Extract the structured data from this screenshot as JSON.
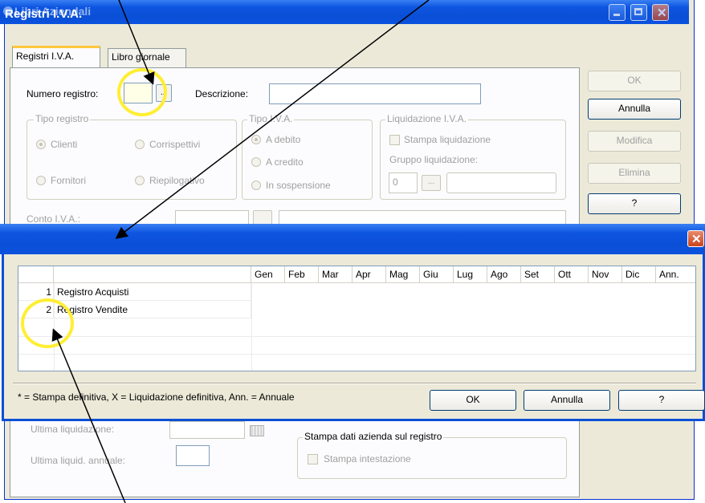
{
  "back_window": {
    "title": "Libri Aziendali",
    "tabs": [
      {
        "label": "Registri I.V.A."
      },
      {
        "label": "Libro giornale"
      }
    ],
    "numero_registro_label": "Numero registro:",
    "numero_registro_value": "",
    "lookup_button": "...",
    "descrizione_label": "Descrizione:",
    "descrizione_value": "",
    "tipo_registro": {
      "title": "Tipo registro",
      "options": [
        "Clienti",
        "Corrispettivi",
        "Fornitori",
        "Riepilogativo"
      ],
      "selected": "Clienti"
    },
    "tipo_iva": {
      "title": "Tipo I.V.A.",
      "options": [
        "A debito",
        "A credito",
        "In sospensione"
      ],
      "selected": "A debito"
    },
    "liquidazione_iva": {
      "title": "Liquidazione I.V.A.",
      "stampa_label": "Stampa liquidazione",
      "gruppo_label": "Gruppo liquidazione:",
      "gruppo_value": "0",
      "lookup_button": "..."
    },
    "conto_iva_label": "Conto I.V.A.:",
    "ultima_liquidazione_label": "Ultima liquidazione:",
    "ultima_liquid_annuale_label": "Ultima liquid. annuale:",
    "stampa_dati": {
      "title": "Stampa dati azienda sul registro",
      "checkbox_label": "Stampa intestazione"
    },
    "buttons": {
      "ok": "OK",
      "annulla": "Annulla",
      "modifica": "Modifica",
      "elimina": "Elimina",
      "help": "?"
    }
  },
  "dialog": {
    "title": "Registri I.V.A.",
    "columns": [
      "",
      "",
      "Gen",
      "Feb",
      "Mar",
      "Apr",
      "Mag",
      "Giu",
      "Lug",
      "Ago",
      "Set",
      "Ott",
      "Nov",
      "Dic",
      "Ann."
    ],
    "rows": [
      {
        "num": "1",
        "name": "Registro Acquisti"
      },
      {
        "num": "2",
        "name": "Registro Vendite"
      }
    ],
    "footnote": "* = Stampa definitiva, X = Liquidazione definitiva, Ann. = Annuale",
    "buttons": {
      "ok": "OK",
      "annulla": "Annulla",
      "help": "?"
    }
  },
  "annotation_colors": {
    "highlight": "#ffee33",
    "arrow": "#000000"
  }
}
